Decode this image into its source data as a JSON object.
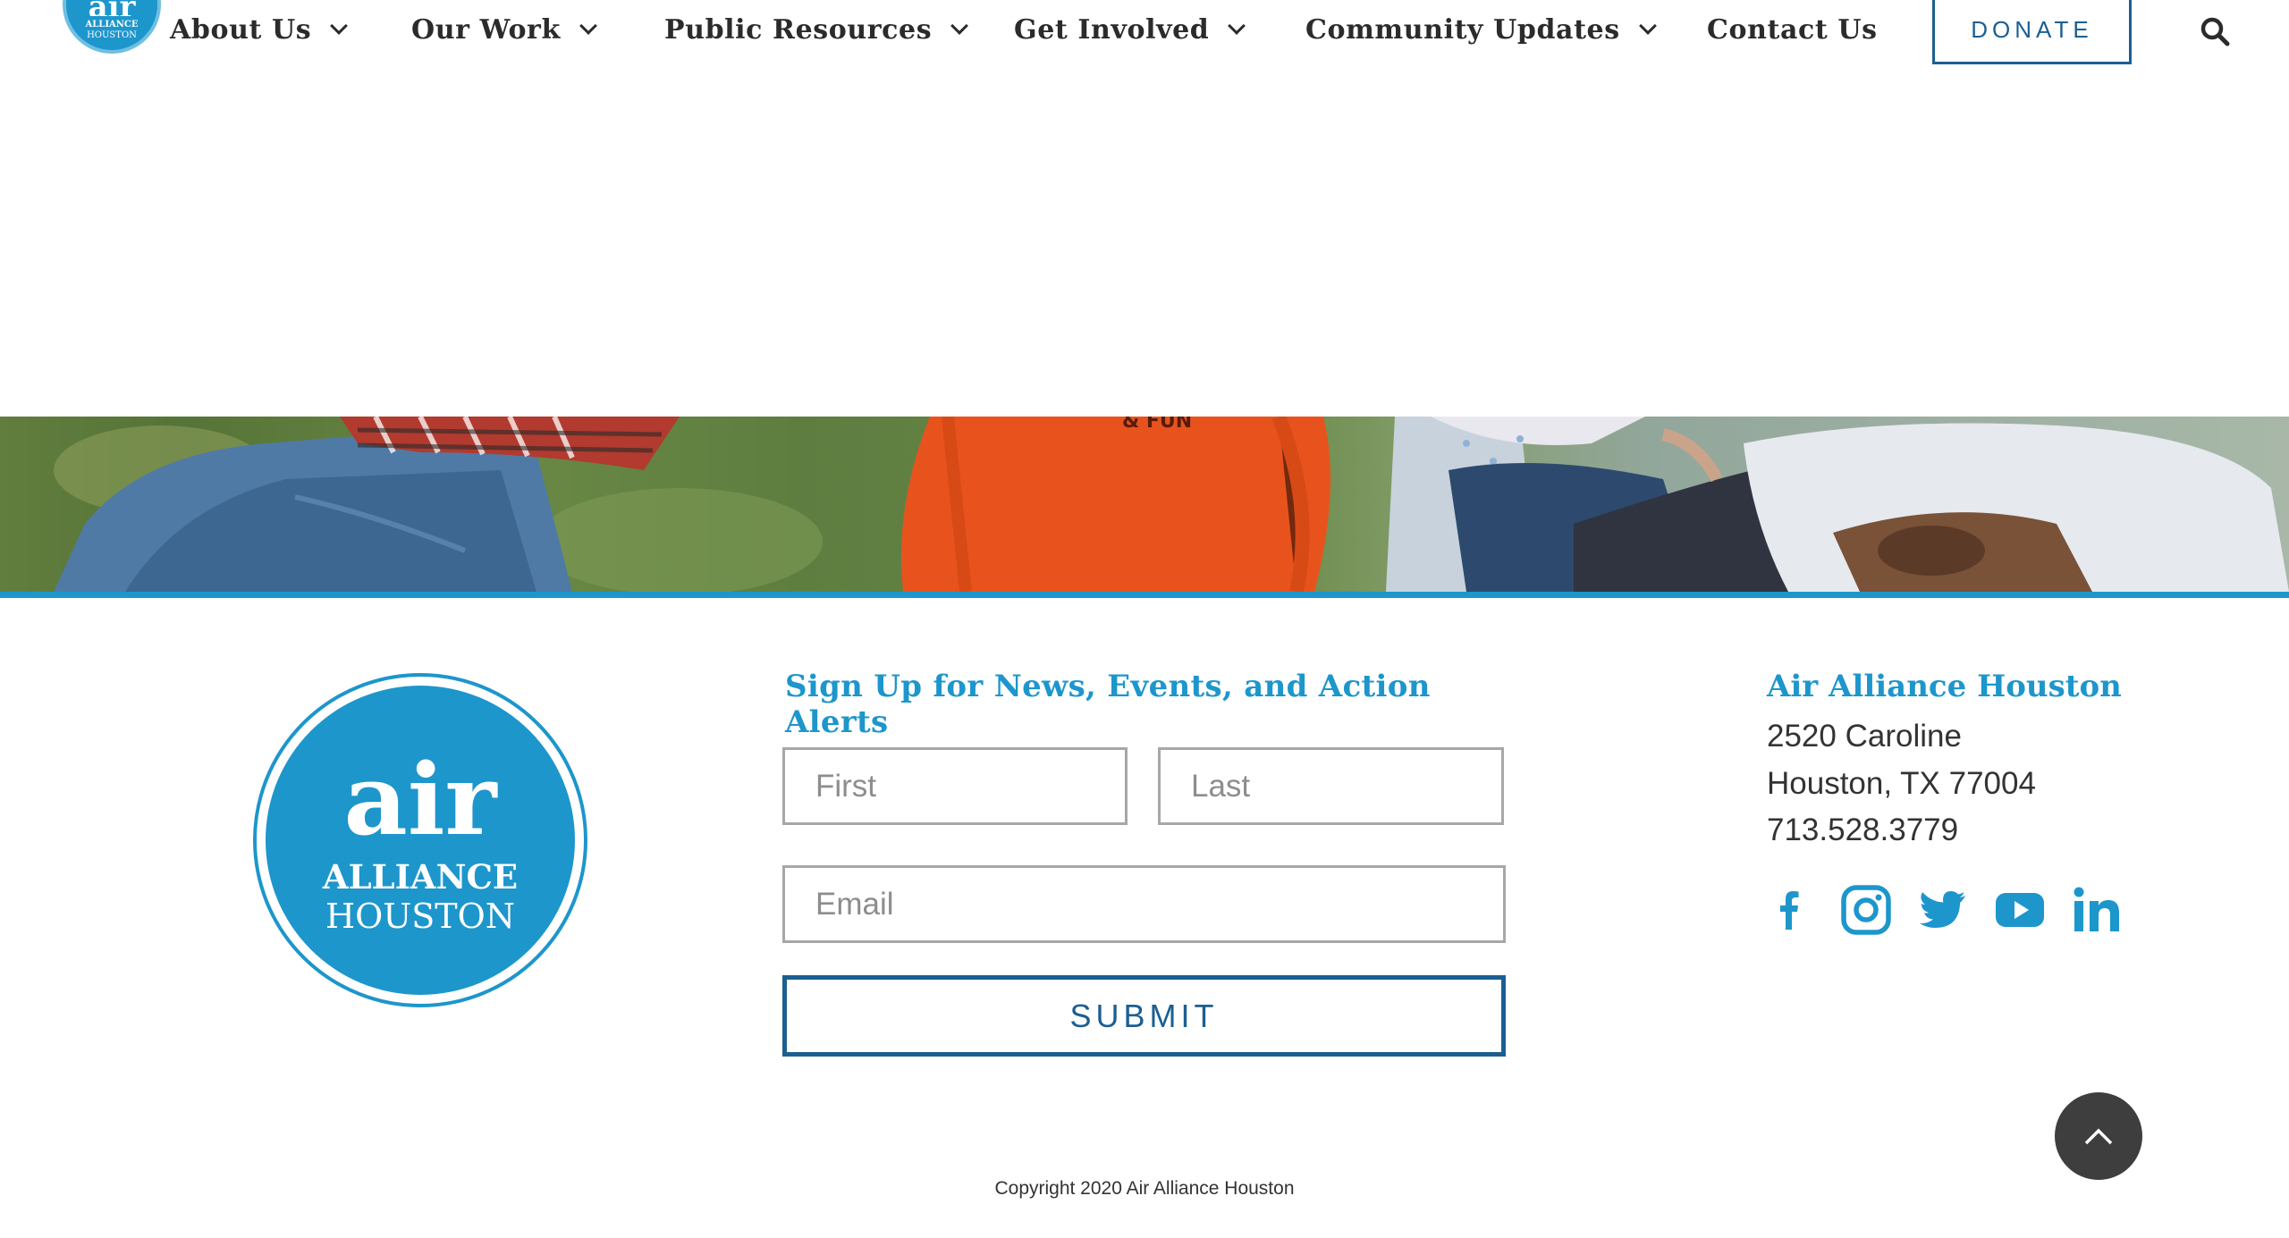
{
  "header": {
    "logo": {
      "word": "air",
      "line1": "ALLIANCE",
      "line2": "HOUSTON"
    },
    "nav": [
      {
        "label": "About Us",
        "has_dropdown": true
      },
      {
        "label": "Our Work",
        "has_dropdown": true
      },
      {
        "label": "Public Resources",
        "has_dropdown": true
      },
      {
        "label": "Get Involved",
        "has_dropdown": true
      },
      {
        "label": "Community Updates",
        "has_dropdown": true
      },
      {
        "label": "Contact Us",
        "has_dropdown": false
      }
    ],
    "donate_label": "DONATE",
    "search_icon": "search-icon"
  },
  "footer": {
    "logo": {
      "word": "air",
      "line1": "ALLIANCE",
      "line2": "HOUSTON"
    },
    "signup": {
      "title": "Sign Up for News, Events, and Action Alerts",
      "first_placeholder": "First",
      "last_placeholder": "Last",
      "email_placeholder": "Email",
      "submit_label": "SUBMIT"
    },
    "contact": {
      "org_name": "Air Alliance Houston",
      "street": "2520 Caroline",
      "city": "Houston, TX 77004",
      "phone": "713.528.3779"
    },
    "social": [
      "facebook-icon",
      "instagram-icon",
      "twitter-icon",
      "youtube-icon",
      "linkedin-icon"
    ],
    "back_to_top_icon": "chevron-up-icon",
    "copyright": "Copyright 2020 Air Alliance Houston"
  },
  "colors": {
    "brand_blue": "#1d96cc",
    "dark_blue": "#1b5f91",
    "text": "#333333",
    "back_to_top_bg": "#3e3e3e"
  }
}
